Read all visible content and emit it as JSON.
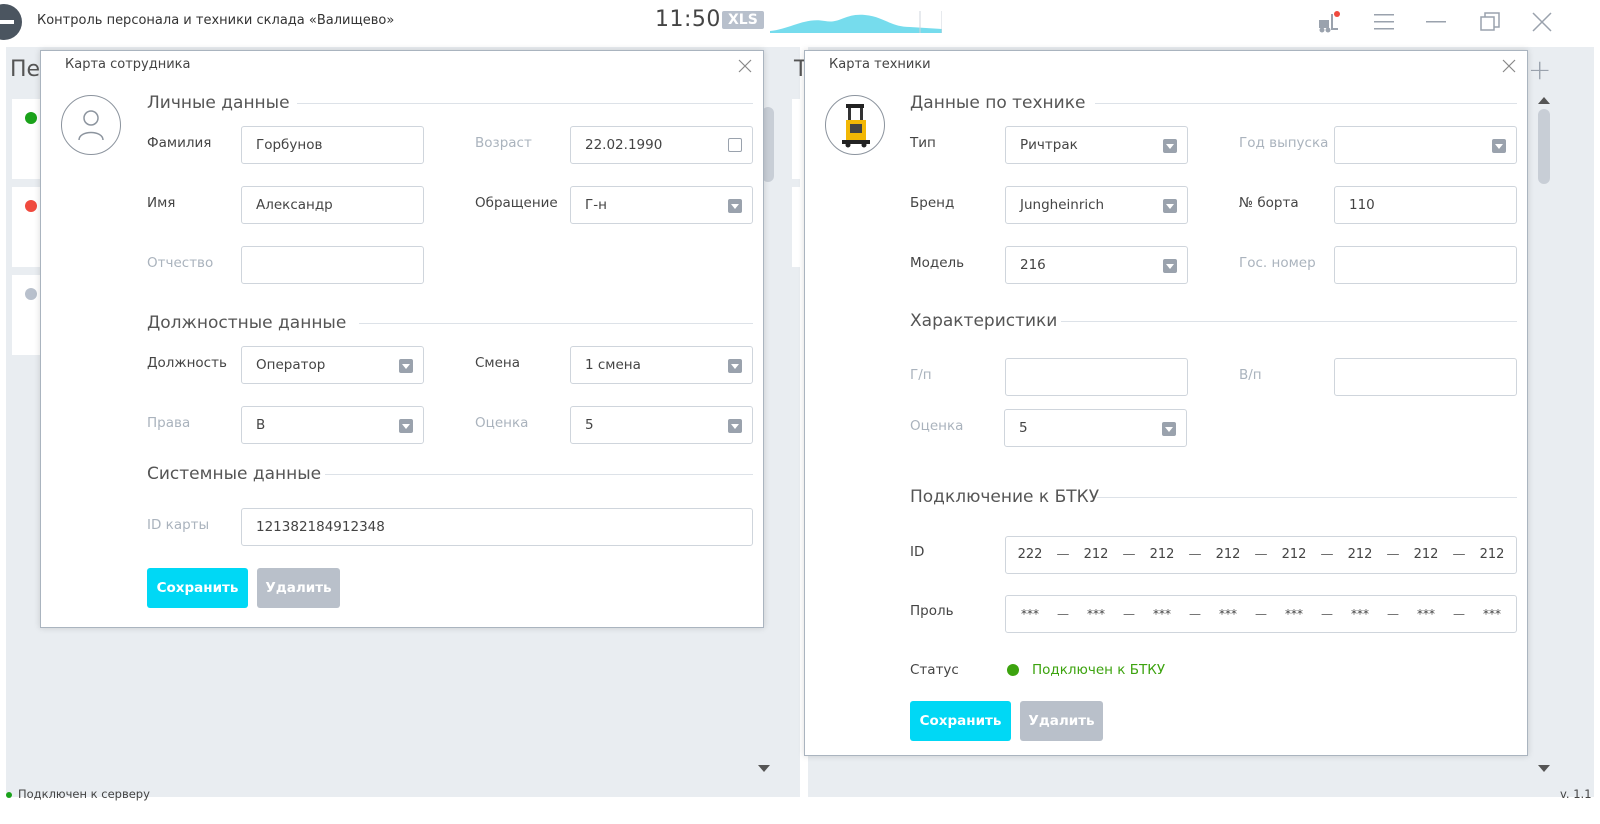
{
  "app": {
    "title": "Контроль персонала и техники склада «Валищево»",
    "clock": "11:50",
    "xls_badge": "XLS"
  },
  "background": {
    "left_heading_fragment": "Пе",
    "right_heading_fragment": "Т",
    "plus": "+"
  },
  "employee_card": {
    "title": "Карта сотрудника",
    "sections": {
      "personal": "Личные данные",
      "job": "Должностные данные",
      "system": "Системные данные"
    },
    "labels": {
      "surname": "Фамилия",
      "name": "Имя",
      "patronymic": "Отчество",
      "age": "Возраст",
      "salutation": "Обращение",
      "position": "Должность",
      "shift": "Смена",
      "rights": "Права",
      "rating": "Оценка",
      "card_id": "ID карты"
    },
    "values": {
      "surname": "Горбунов",
      "name": "Александр",
      "patronymic": "",
      "age": "22.02.1990",
      "salutation": "Г-н",
      "position": "Оператор",
      "shift": "1 смена",
      "rights": "В",
      "rating": "5",
      "card_id": "121382184912348"
    },
    "buttons": {
      "save": "Сохранить",
      "delete": "Удалить"
    }
  },
  "equipment_card": {
    "title": "Карта техники",
    "sections": {
      "equipment": "Данные по технике",
      "characteristics": "Характеристики",
      "connection": "Подключение к БТКУ"
    },
    "labels": {
      "type": "Тип",
      "brand": "Бренд",
      "model": "Модель",
      "year": "Год выпуска",
      "board_no": "№ борта",
      "gov_no": "Гос. номер",
      "gp": "Г/п",
      "vp": "В/п",
      "rating": "Оценка",
      "id": "ID",
      "password": "Проль",
      "status": "Статус"
    },
    "values": {
      "type": "Ричтрак",
      "brand": "Jungheinrich",
      "model": "216",
      "year": "",
      "board_no": "110",
      "gov_no": "",
      "gp": "",
      "vp": "",
      "rating": "5",
      "status": "Подключен к БТКУ"
    },
    "id_segments": [
      "222",
      "212",
      "212",
      "212",
      "212",
      "212",
      "212",
      "212"
    ],
    "password_segments": [
      "***",
      "***",
      "***",
      "***",
      "***",
      "***",
      "***",
      "***"
    ],
    "separator": "—",
    "buttons": {
      "save": "Сохранить",
      "delete": "Удалить"
    }
  },
  "statusbar": {
    "connection": "Подключен к серверу",
    "version": "v. 1.1"
  },
  "colors": {
    "accent": "#00d8f5",
    "status_ok": "#3ca30e",
    "status_error": "#f04a3e",
    "status_idle": "#b8c0cc"
  },
  "icons": [
    "app-logo-icon",
    "forklift-alert-icon",
    "menu-icon",
    "minimize-icon",
    "restore-icon",
    "close-icon",
    "calendar-icon",
    "dropdown-icon",
    "person-icon",
    "forklift-icon"
  ]
}
